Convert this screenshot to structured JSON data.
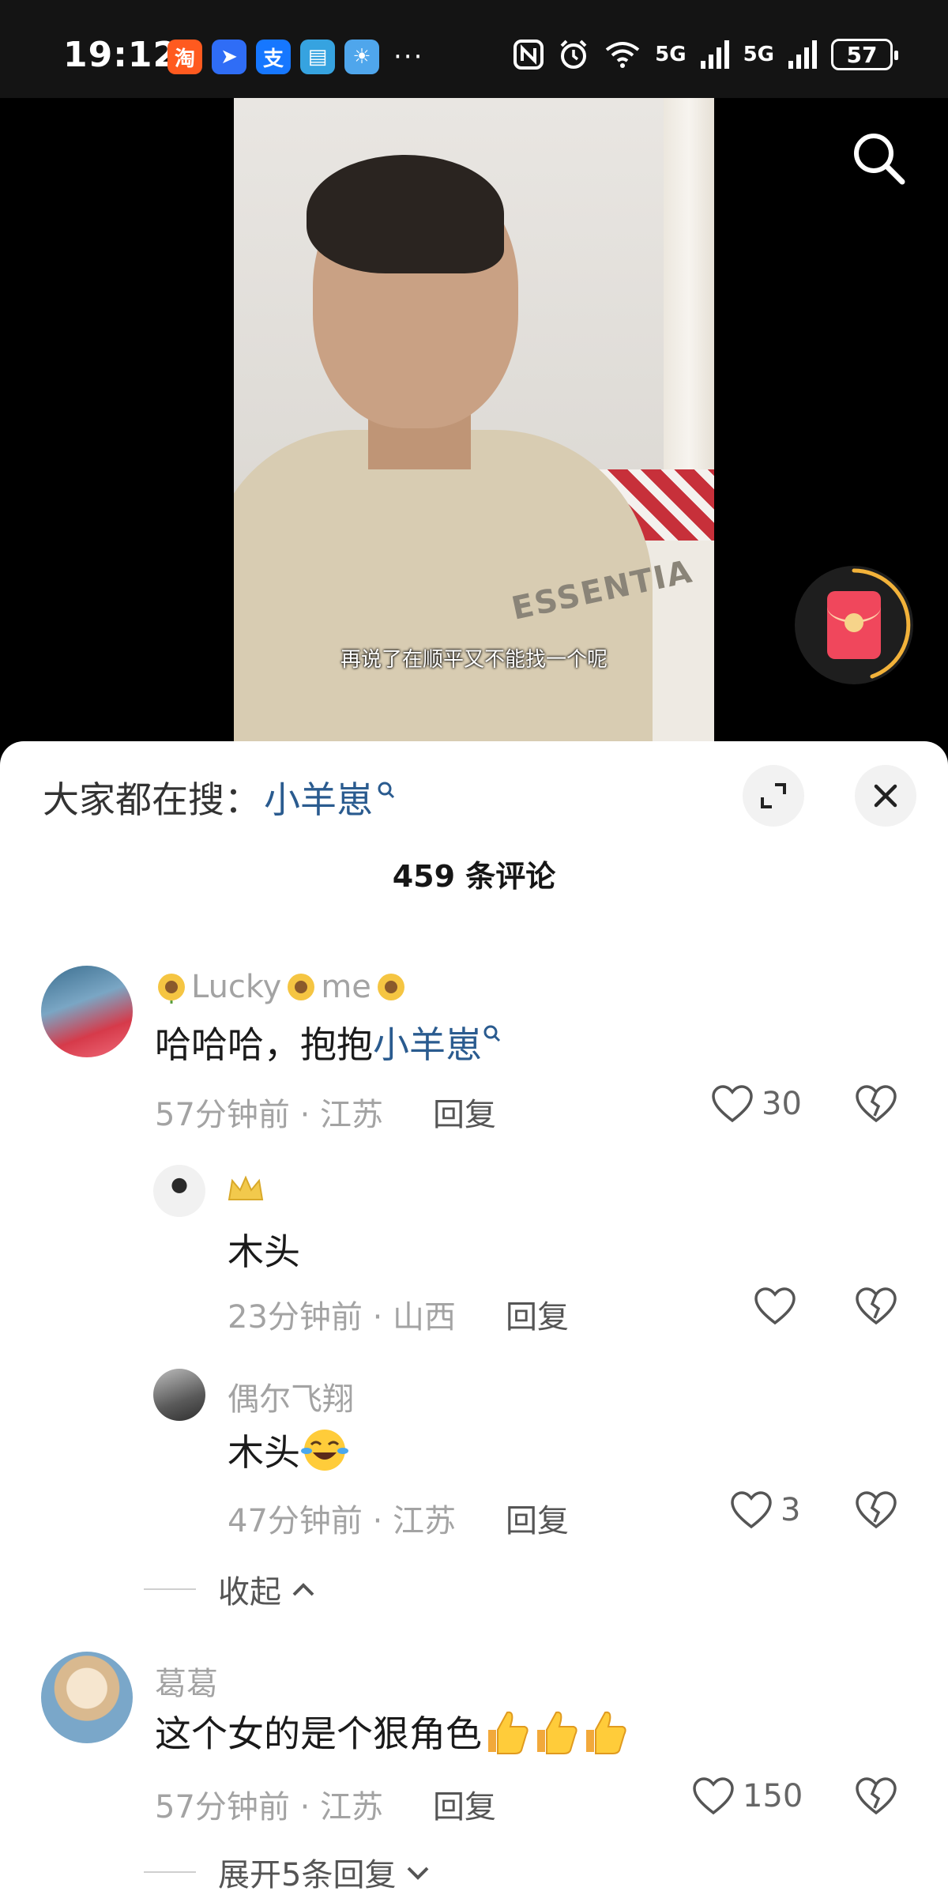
{
  "status_bar": {
    "time": "19:12",
    "apps": [
      {
        "icon": "taobao-icon",
        "glyph": "淘",
        "color": "#ff5a1f"
      },
      {
        "icon": "feishu-icon",
        "glyph": "➤",
        "color": "#2f6df6"
      },
      {
        "icon": "alipay-icon",
        "glyph": "支",
        "color": "#1677ff"
      },
      {
        "icon": "reader-icon",
        "glyph": "▤",
        "color": "#36a3e0"
      },
      {
        "icon": "weather-icon",
        "glyph": "☀",
        "color": "#4fa6ec"
      }
    ],
    "more": "···",
    "network_1": "5G",
    "network_2": "5G",
    "battery": "57"
  },
  "video": {
    "subtitle": "再说了在顺平又不能找一个呢",
    "shirt_print": "ESSENTIA"
  },
  "sheet": {
    "trending_label": "大家都在搜：",
    "trending_keyword": "小羊崽",
    "comment_count": "459 条评论"
  },
  "comments": [
    {
      "username": "Lucky",
      "username_suffix": "me",
      "text_prefix": "哈哈哈，抱抱",
      "text_keyword": "小羊崽",
      "time_location": "57分钟前 · 江苏",
      "reply_label": "回复",
      "likes": "30",
      "avatar_colors": [
        "#3b6e8f",
        "#d63a4a"
      ]
    },
    {
      "username": "",
      "text": "木头",
      "time_location": "23分钟前 · 山西",
      "reply_label": "回复",
      "likes": "",
      "avatar_colors": [
        "#e9e9e9",
        "#2a2a2a"
      ]
    },
    {
      "username": "偶尔飞翔",
      "text": "木头",
      "time_location": "47分钟前 · 江苏",
      "reply_label": "回复",
      "likes": "3",
      "avatar_colors": [
        "#8a8a8a",
        "#3a3a3a"
      ]
    },
    {
      "username": "葛葛",
      "text": "这个女的是个狠角色",
      "time_location": "57分钟前 · 江苏",
      "reply_label": "回复",
      "likes": "150",
      "avatar_colors": [
        "#d9c2a0",
        "#f1e0c8"
      ]
    }
  ],
  "collapse_label": "收起",
  "expand_label": "展开5条回复"
}
